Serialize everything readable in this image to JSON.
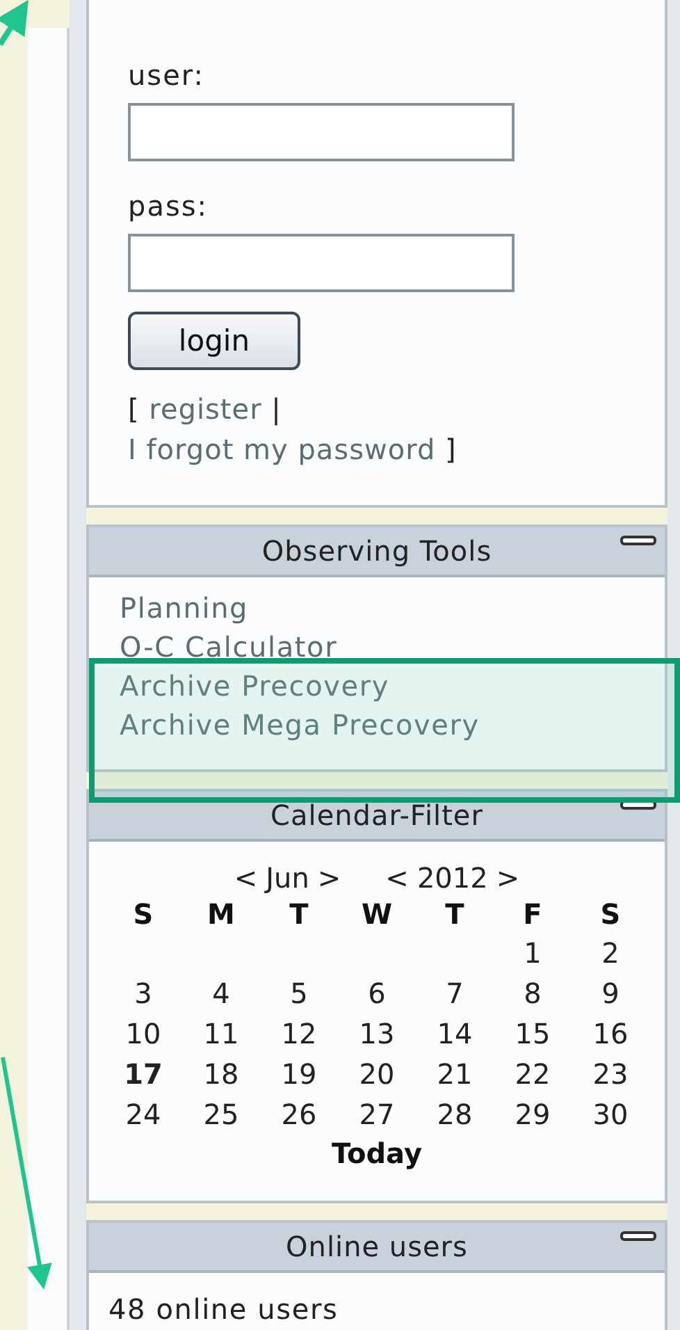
{
  "login": {
    "user_label": "user:",
    "pass_label": "pass:",
    "button": "login",
    "links_open": "[",
    "register_link": "register",
    "separator": "|",
    "forgot_link": "I forgot my password",
    "links_close": "]"
  },
  "observing_tools": {
    "title": "Observing Tools",
    "items": [
      {
        "label": "Planning"
      },
      {
        "label": "O-C Calculator"
      },
      {
        "label": "Archive Precovery"
      },
      {
        "label": "Archive Mega Precovery"
      }
    ]
  },
  "calendar_filter": {
    "title": "Calendar-Filter",
    "month_prev": "<",
    "month": "Jun",
    "month_next": ">",
    "year_prev": "<",
    "year": "2012",
    "year_next": ">",
    "weekdays": [
      "S",
      "M",
      "T",
      "W",
      "T",
      "F",
      "S"
    ],
    "weeks": [
      {
        "days": [
          {
            "label": "1",
            "today": false
          },
          {
            "label": "2",
            "today": false
          }
        ]
      },
      {
        "days": [
          {
            "label": "3",
            "today": false
          },
          {
            "label": "4",
            "today": false
          },
          {
            "label": "5",
            "today": false
          },
          {
            "label": "6",
            "today": false
          },
          {
            "label": "7",
            "today": false
          },
          {
            "label": "8",
            "today": false
          },
          {
            "label": "9",
            "today": false
          }
        ]
      },
      {
        "days": [
          {
            "label": "10",
            "today": false
          },
          {
            "label": "11",
            "today": false
          },
          {
            "label": "12",
            "today": false
          },
          {
            "label": "13",
            "today": false
          },
          {
            "label": "14",
            "today": false
          },
          {
            "label": "15",
            "today": false
          },
          {
            "label": "16",
            "today": false
          }
        ]
      },
      {
        "days": [
          {
            "label": "17",
            "today": true
          },
          {
            "label": "18",
            "today": false
          },
          {
            "label": "19",
            "today": false
          },
          {
            "label": "20",
            "today": false
          },
          {
            "label": "21",
            "today": false
          },
          {
            "label": "22",
            "today": false
          },
          {
            "label": "23",
            "today": false
          }
        ]
      },
      {
        "days": [
          {
            "label": "24",
            "today": false
          },
          {
            "label": "25",
            "today": false
          },
          {
            "label": "26",
            "today": false
          },
          {
            "label": "27",
            "today": false
          },
          {
            "label": "28",
            "today": false
          },
          {
            "label": "29",
            "today": false
          },
          {
            "label": "30",
            "today": false
          }
        ]
      }
    ],
    "today_link": "Today"
  },
  "online_users": {
    "title": "Online users",
    "count_text": "48 online users"
  }
}
